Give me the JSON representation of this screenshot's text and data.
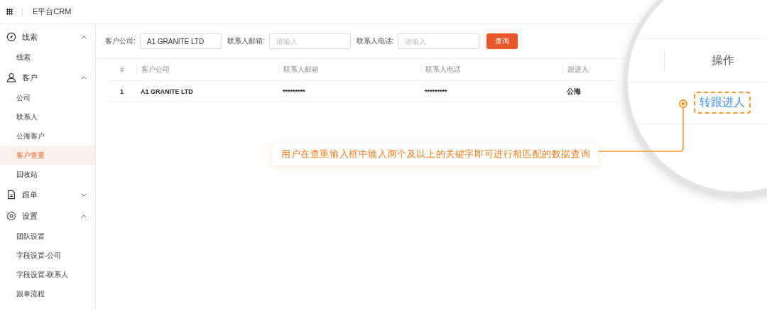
{
  "header": {
    "title": "E平台CRM"
  },
  "sidebar": {
    "groups": [
      {
        "label": "线索",
        "expanded": true,
        "children": [
          {
            "label": "线索",
            "selected": false
          }
        ]
      },
      {
        "label": "客户",
        "expanded": true,
        "children": [
          {
            "label": "公司",
            "selected": false
          },
          {
            "label": "联系人",
            "selected": false
          },
          {
            "label": "公海客户",
            "selected": false
          },
          {
            "label": "客户查重",
            "selected": true
          },
          {
            "label": "回收站",
            "selected": false
          }
        ]
      },
      {
        "label": "跟单",
        "expanded": false
      },
      {
        "label": "设置",
        "expanded": true,
        "children": [
          {
            "label": "团队设置",
            "selected": false
          },
          {
            "label": "字段设置-公司",
            "selected": false
          },
          {
            "label": "字段设置-联系人",
            "selected": false
          },
          {
            "label": "跟单流程",
            "selected": false
          }
        ]
      }
    ]
  },
  "filters": [
    {
      "label": "客户公司:",
      "value": "A1 GRANITE LTD"
    },
    {
      "label": "联系人邮箱:",
      "placeholder": "请输入"
    },
    {
      "label": "联系人电话:",
      "placeholder": "请输入"
    }
  ],
  "search_button": "查询",
  "table": {
    "columns": [
      "#",
      "客户公司",
      "联系人邮箱",
      "联系人电话",
      "跟进人"
    ],
    "rows": [
      [
        "1",
        "A1 GRANITE LTD",
        "*********",
        "*********",
        "公海"
      ]
    ]
  },
  "magnifier": {
    "column": "操作",
    "action": "转跟进人"
  },
  "callout": "用户在查重输入框中输入两个及以上的关键字即可进行相匹配的数据查询"
}
